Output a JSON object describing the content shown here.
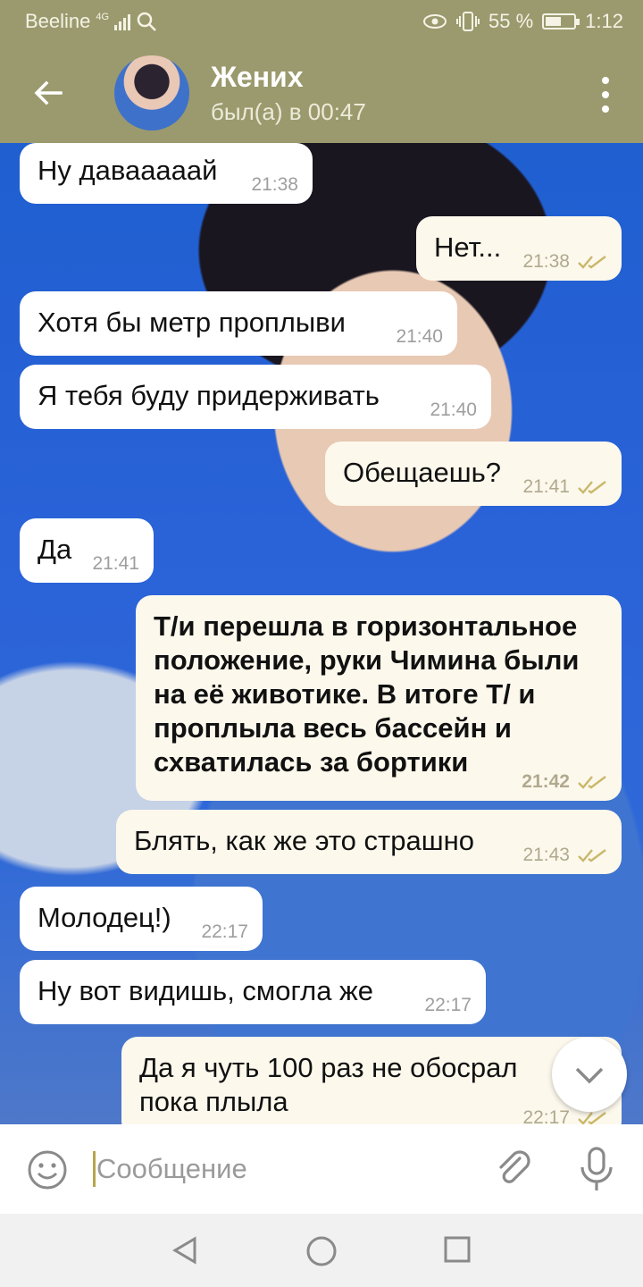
{
  "status_bar": {
    "carrier": "Beeline",
    "network": "4G",
    "battery": "55 %",
    "battery_level": 0.55,
    "time": "1:12"
  },
  "header": {
    "title": "Жених",
    "subtitle": "был(а) в 00:47"
  },
  "messages": [
    {
      "dir": "in",
      "text": "Ну даваааaай",
      "time": "21:38"
    },
    {
      "dir": "out",
      "text": "Нет...",
      "time": "21:38"
    },
    {
      "dir": "in",
      "text": "Хотя бы метр проплыви",
      "time": "21:40"
    },
    {
      "dir": "in",
      "text": "Я тебя буду придерживать",
      "time": "21:40"
    },
    {
      "dir": "out",
      "text": "Обещаешь?",
      "time": "21:41"
    },
    {
      "dir": "in",
      "text": "Да",
      "time": "21:41"
    },
    {
      "dir": "out",
      "text": "Т/и перешла в горизонтальное положение, руки Чимина были на её животике. В итоге Т/ и проплыла весь бассейн и схватилась за бортики",
      "time": "21:42"
    },
    {
      "dir": "out",
      "text": "Блять, как же это страшно",
      "time": "21:43"
    },
    {
      "dir": "in",
      "text": "Молодец!)",
      "time": "22:17"
    },
    {
      "dir": "in",
      "text": "Ну вот видишь, смогла же",
      "time": "22:17"
    },
    {
      "dir": "out",
      "text": "Да я чуть 100 раз не обосрал пока плыла",
      "time": "22:17"
    }
  ],
  "composer": {
    "placeholder": "Сообщение"
  },
  "colors": {
    "header": "#9b9a6e",
    "incoming": "#ffffff",
    "outgoing": "#fcf8ec",
    "check": "#c9b86a"
  },
  "icons": [
    "back-arrow-icon",
    "more-vert-icon",
    "emoji-icon",
    "attach-icon",
    "mic-icon",
    "chevron-down-icon",
    "nav-back-icon",
    "nav-home-icon",
    "nav-recents-icon",
    "eye-icon",
    "vibrate-icon",
    "search-icon"
  ]
}
